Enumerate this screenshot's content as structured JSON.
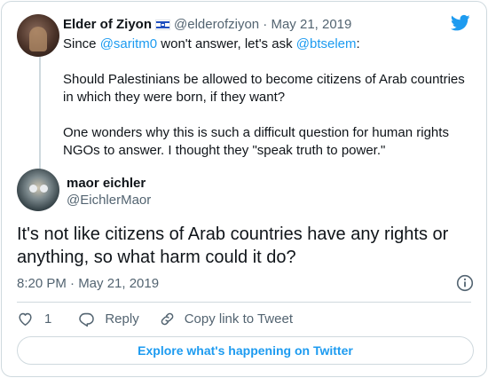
{
  "parent_tweet": {
    "author_name": "Elder of Ziyon",
    "flag": "israel-flag",
    "handle": "@elderofziyon",
    "separator": "·",
    "date": "May 21, 2019",
    "text_intro": "Since ",
    "mention_1": "@saritm0",
    "text_mid": " won't answer, let's ask ",
    "mention_2": "@btselem",
    "text_colon": ":",
    "paragraph_2": "Should Palestinians be allowed to become citizens of Arab countries in which they were born, if they want?",
    "paragraph_3": "One wonders why this is such a difficult question for human rights NGOs to answer.  I thought they \"speak truth to power.\""
  },
  "main_tweet": {
    "author_name": "maor eichler",
    "handle": "@EichlerMaor",
    "text": "It's not like citizens of Arab countries have any rights or anything, so what harm could it do?",
    "timestamp": "8:20 PM · May 21, 2019"
  },
  "actions": {
    "like_count": "1",
    "reply_label": "Reply",
    "copy_link_label": "Copy link to Tweet"
  },
  "explore_label": "Explore what's happening on Twitter",
  "colors": {
    "accent": "#1d9bf0",
    "text": "#0f1419",
    "muted": "#536471",
    "border": "#cfd9de"
  }
}
